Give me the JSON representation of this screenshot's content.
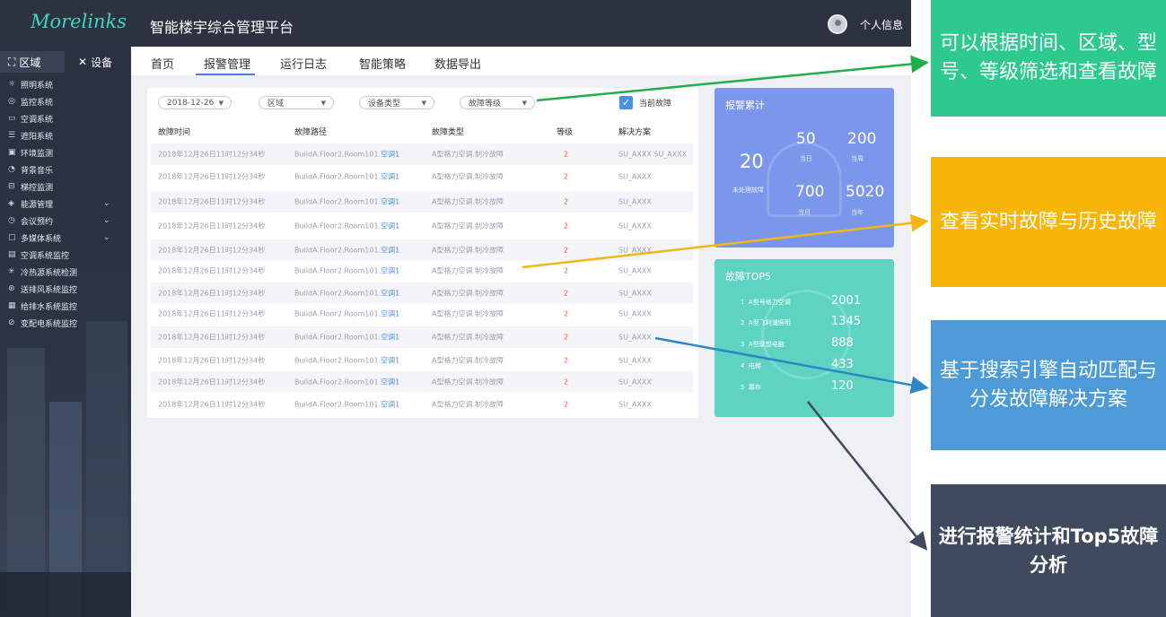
{
  "header": {
    "logo": "Morelinks",
    "title": "智能楼宇综合管理平台",
    "user_label": "个人信息"
  },
  "sidebar": {
    "tabs": [
      {
        "icon": "区域-icon",
        "label": "区域"
      },
      {
        "icon": "tools-icon",
        "label": "设备"
      }
    ],
    "items": [
      {
        "label": "照明系统"
      },
      {
        "label": "监控系统"
      },
      {
        "label": "空调系统"
      },
      {
        "label": "遮阳系统"
      },
      {
        "label": "环境监测"
      },
      {
        "label": "背景音乐"
      },
      {
        "label": "梯控监测"
      },
      {
        "label": "能源管理"
      },
      {
        "label": "会议预约"
      },
      {
        "label": "多媒体系统"
      },
      {
        "label": "空调系统监控"
      },
      {
        "label": "冷热源系统检测"
      },
      {
        "label": "送排风系统监控"
      },
      {
        "label": "给排水系统监控"
      },
      {
        "label": "变配电系统监控"
      }
    ]
  },
  "nav": {
    "tabs": [
      "首页",
      "报警管理",
      "运行日志",
      "智能策略",
      "数据导出"
    ],
    "active": "报警管理"
  },
  "filters": {
    "date": "2018-12-26",
    "area": "区域",
    "device_type": "设备类型",
    "fault_level": "故障等级",
    "current_fault_label": "当前故障",
    "current_fault_checked": true
  },
  "table": {
    "headers": [
      "故障时间",
      "故障路径",
      "故障类型",
      "等级",
      "解决方案"
    ],
    "rows": [
      {
        "time": "2018年12月26日11时12分34秒",
        "path": "BuildA.Floor2.Room101.",
        "device": "空调1",
        "type": "A型格力空调.制冷故障",
        "level": "2",
        "solution": "SU_AXXX SU_AXXX"
      },
      {
        "time": "2018年12月26日11时12分34秒",
        "path": "BuildA.Floor2.Room101.",
        "device": "空调1",
        "type": "A型格力空调.制冷故障",
        "level": "2",
        "solution": "SU_AXXX"
      },
      {
        "time": "2018年12月26日11时12分34秒",
        "path": "BuildA.Floor2.Room101.",
        "device": "空调1",
        "type": "A型格力空调.制冷故障",
        "level": "2",
        "solution": "SU_AXXX"
      },
      {
        "time": "2018年12月26日11时12分34秒",
        "path": "BuildA.Floor2.Room101.",
        "device": "空调1",
        "type": "A型格力空调.制冷故障",
        "level": "2",
        "solution": "SU_AXXX"
      },
      {
        "time": "2018年12月26日11时12分34秒",
        "path": "BuildA.Floor2.Room101.",
        "device": "空调1",
        "type": "A型格力空调.制冷故障",
        "level": "2",
        "solution": "SU_AXXX"
      },
      {
        "time": "2018年12月26日11时12分34秒",
        "path": "BuildA.Floor2.Room101.",
        "device": "空调1",
        "type": "A型格力空调.制冷故障",
        "level": "2",
        "solution": "SU_AXXX"
      },
      {
        "time": "2018年12月26日11时12分34秒",
        "path": "BuildA.Floor2.Room101.",
        "device": "空调1",
        "type": "A型格力空调.制冷故障",
        "level": "2",
        "solution": "SU_AXXX"
      },
      {
        "time": "2018年12月26日11时12分34秒",
        "path": "BuildA.Floor2.Room101.",
        "device": "空调1",
        "type": "A型格力空调.制冷故障",
        "level": "2",
        "solution": "SU_AXXX"
      },
      {
        "time": "2018年12月26日11时12分34秒",
        "path": "BuildA.Floor2.Room101.",
        "device": "空调1",
        "type": "A型格力空调.制冷故障",
        "level": "2",
        "solution": "SU_AXXX"
      },
      {
        "time": "2018年12月26日11时12分34秒",
        "path": "BuildA.Floor2.Room101.",
        "device": "空调1",
        "type": "A型格力空调.制冷故障",
        "level": "2",
        "solution": "SU_AXXX"
      },
      {
        "time": "2018年12月26日11时12分34秒",
        "path": "BuildA.Floor2.Room101.",
        "device": "空调1",
        "type": "A型格力空调.制冷故障",
        "level": "2",
        "solution": "SU_AXXX"
      },
      {
        "time": "2018年12月26日11时12分34秒",
        "path": "BuildA.Floor2.Room101.",
        "device": "空调1",
        "type": "A型格力空调.制冷故障",
        "level": "2",
        "solution": "SU_AXXX"
      }
    ]
  },
  "alarm_stats": {
    "title": "报警累计",
    "unresolved": "20",
    "unresolved_label": "未处理故障",
    "today": "50",
    "today_label": "当日",
    "week": "200",
    "week_label": "当周",
    "month": "700",
    "month_label": "当月",
    "year": "5020",
    "year_label": "当年"
  },
  "top5": {
    "title": "故障TOP5",
    "items": [
      {
        "rank": "1",
        "name": "A型号格力空调",
        "value": "2001"
      },
      {
        "rank": "2",
        "name": "A型飞利浦照明",
        "value": "1345"
      },
      {
        "rank": "3",
        "name": "A型联想电脑",
        "value": "888"
      },
      {
        "rank": "4",
        "name": "电梯",
        "value": "433"
      },
      {
        "rank": "5",
        "name": "幕布",
        "value": "120"
      }
    ]
  },
  "annotations": [
    "可以根据时间、区域、型号、等级筛选和查看故障",
    "查看实时故障与历史故障",
    "基于搜索引擎自动匹配与分发故障解决方案",
    "进行报警统计和Top5故障分析"
  ],
  "colors": {
    "accent_teal": "#3fd5c2",
    "stat_card": "#7b97ec",
    "top5_card": "#5fd3c2",
    "level_red": "#f05a3a",
    "link_blue": "#4a90e2",
    "note_green": "#2ec98f",
    "note_orange": "#f8b508",
    "note_blue": "#4d9ad8",
    "note_dark": "#3f4a5e"
  }
}
